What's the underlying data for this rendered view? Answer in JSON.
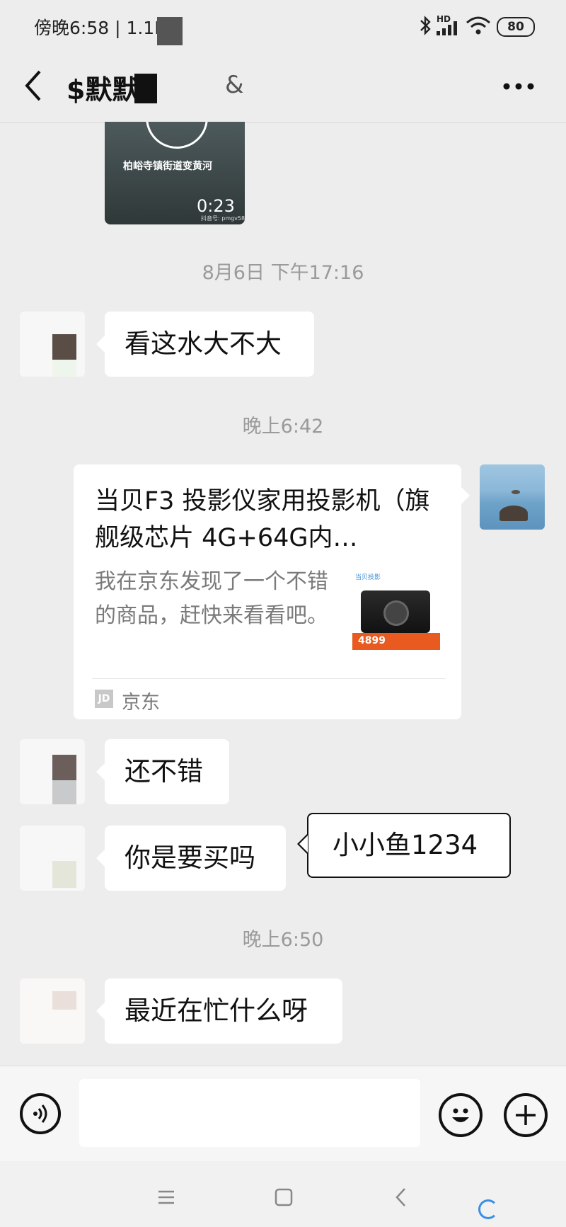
{
  "status_bar": {
    "time": "傍晚6:58 | 1.1K/s",
    "battery": "80",
    "network": "HD"
  },
  "header": {
    "title": "$默默",
    "title_suffix": "&"
  },
  "video": {
    "caption": "柏峪寺镇街道变黄河",
    "duration": "0:23",
    "watermark": "抖音号: pmgv587"
  },
  "messages": [
    {
      "type": "timestamp",
      "text": "8月6日 下午17:16"
    },
    {
      "type": "text",
      "side": "left",
      "text": "看这水大不大"
    },
    {
      "type": "timestamp",
      "text": "晚上6:42"
    },
    {
      "type": "link_card",
      "side": "right",
      "title": "当贝F3 投影仪家用投影机（旗舰级芯片 4G+64G内…",
      "description": "我在京东发现了一个不错的商品，赶快来看看吧。",
      "source": "京东",
      "source_logo": "JD",
      "thumb_brand": "当贝投影",
      "thumb_price": "4899"
    },
    {
      "type": "text",
      "side": "left",
      "text": "还不错"
    },
    {
      "type": "text",
      "side": "left",
      "text": "你是要买吗"
    },
    {
      "type": "timestamp",
      "text": "晚上6:50"
    },
    {
      "type": "text",
      "side": "left",
      "text": "最近在忙什么呀"
    }
  ],
  "annotation": {
    "text": "小小鱼1234"
  },
  "colors": {
    "background": "#ededed",
    "bubble": "#ffffff",
    "timestamp": "#9a9a9a"
  }
}
